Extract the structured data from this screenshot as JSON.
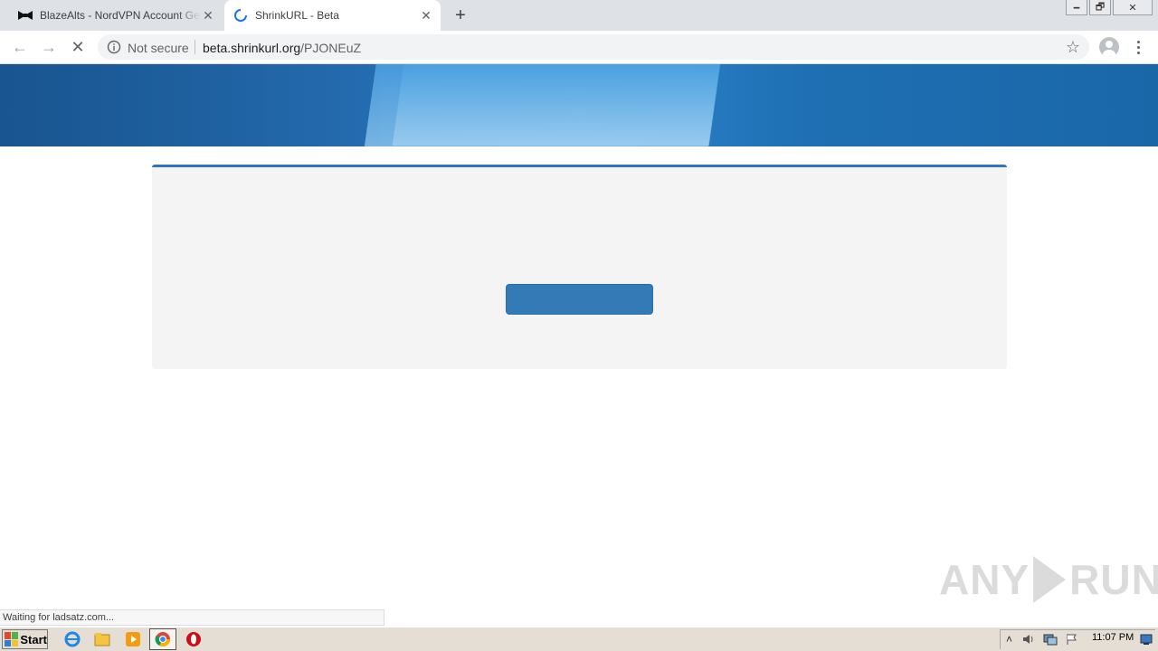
{
  "tabs": [
    {
      "title": "BlazeAlts - NordVPN Account Generator",
      "favicon": "bowtie-icon",
      "close": "✕"
    },
    {
      "title": "ShrinkURL - Beta",
      "favicon": "loading-spinner-icon",
      "close": "✕"
    }
  ],
  "newtab_label": "+",
  "window_controls": {
    "minimize": "🗕",
    "restore": "🗗",
    "close": "✕"
  },
  "toolbar": {
    "back": "←",
    "forward": "→",
    "reload": "✕",
    "security_label": "Not secure",
    "url_host": "beta.shrinkurl.org",
    "url_path": "/PJONEuZ",
    "star": "☆"
  },
  "page": {
    "button_label": ""
  },
  "status_text": "Waiting for ladsatz.com...",
  "watermark": {
    "left": "ANY",
    "right": "RUN"
  },
  "taskbar": {
    "start_label": "Start",
    "apps": [
      "internet-explorer-icon",
      "file-explorer-icon",
      "media-player-icon",
      "chrome-icon",
      "opera-icon"
    ],
    "tray_expand": "˄",
    "clock": "11:07 PM"
  },
  "colors": {
    "accent": "#2f74c0",
    "button": "#337ab7",
    "card_bg": "#f4f4f4",
    "tabstrip": "#dee1e6"
  }
}
